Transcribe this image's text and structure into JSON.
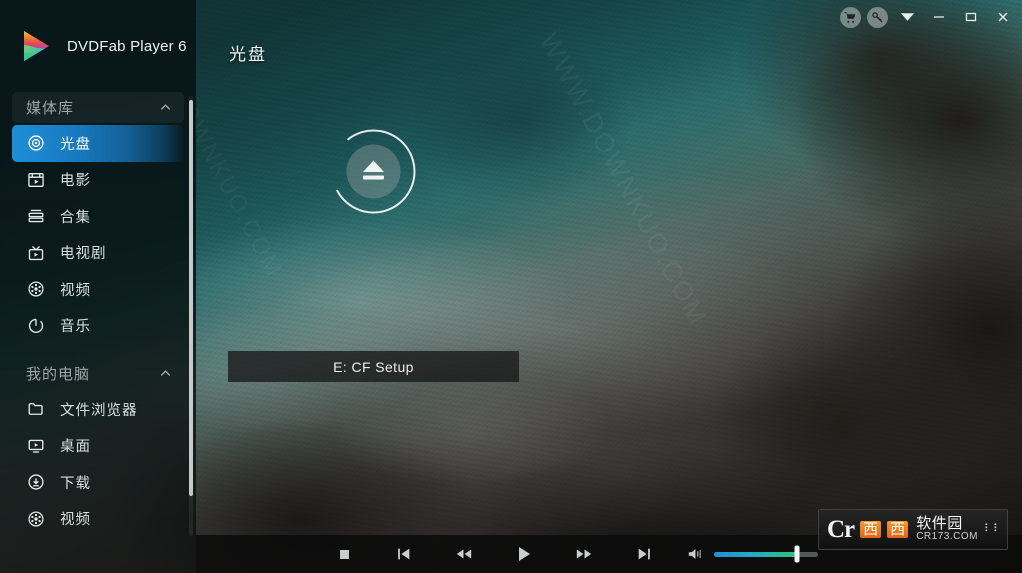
{
  "window": {
    "app_title": "DVDFab Player 6",
    "logo_icon": "play-triangle-rainbow-logo",
    "buttons": [
      {
        "name": "cart-icon",
        "label": "",
        "tooltip": "Store"
      },
      {
        "name": "key-icon",
        "label": "",
        "tooltip": "Activate"
      },
      {
        "name": "caret-down-icon",
        "label": "",
        "tooltip": "Menu"
      },
      {
        "name": "minimize-icon",
        "label": "–",
        "tooltip": "Minimize"
      },
      {
        "name": "maximize-icon",
        "label": "□",
        "tooltip": "Maximize"
      },
      {
        "name": "close-icon",
        "label": "✕",
        "tooltip": "Close"
      }
    ]
  },
  "sidebar": {
    "sections": [
      {
        "title": "媒体库",
        "collapse_icon": "chevron-up-icon",
        "highlighted_header": true,
        "items": [
          {
            "label": "光盘",
            "icon": "disc-icon",
            "active": true
          },
          {
            "label": "电影",
            "icon": "movie-icon",
            "active": false
          },
          {
            "label": "合集",
            "icon": "collection-icon",
            "active": false
          },
          {
            "label": "电视剧",
            "icon": "tv-icon",
            "active": false
          },
          {
            "label": "视频",
            "icon": "film-reel-icon",
            "active": false
          },
          {
            "label": "音乐",
            "icon": "music-icon",
            "active": false
          }
        ]
      },
      {
        "title": "我的电脑",
        "collapse_icon": "chevron-up-icon",
        "highlighted_header": false,
        "items": [
          {
            "label": "文件浏览器",
            "icon": "folder-icon",
            "active": false
          },
          {
            "label": "桌面",
            "icon": "desktop-icon",
            "active": false
          },
          {
            "label": "下载",
            "icon": "download-icon",
            "active": false
          },
          {
            "label": "视频",
            "icon": "film-reel-icon",
            "active": false
          }
        ]
      }
    ],
    "scrollbar": {
      "name": "sidebar-scrollbar",
      "thumb_pct": 90
    }
  },
  "main": {
    "page_title": "光盘",
    "disc": {
      "eject_icon": "eject-icon",
      "ring_icon": "progress-ring",
      "drive_label": "E: CF Setup"
    }
  },
  "controls": {
    "buttons": [
      {
        "name": "stop-button",
        "icon": "stop-icon"
      },
      {
        "name": "previous-button",
        "icon": "skip-previous-icon"
      },
      {
        "name": "rewind-button",
        "icon": "rewind-icon"
      },
      {
        "name": "play-button",
        "icon": "play-icon"
      },
      {
        "name": "fast-forward-button",
        "icon": "fast-forward-icon"
      },
      {
        "name": "next-button",
        "icon": "skip-next-icon"
      },
      {
        "name": "volume-button",
        "icon": "volume-icon"
      }
    ],
    "volume": {
      "value": 80,
      "min": 0,
      "max": 100
    }
  },
  "watermark": {
    "cr": "Cr",
    "box1": "西",
    "box2": "西",
    "cn": "软件园",
    "url": "CR173.COM",
    "dots": "⠇⠇"
  },
  "background": {
    "watermark_text_1": "WWW.DOWNKUO.COM",
    "watermark_text_2": "WWW.DOWNKUO.COM"
  },
  "colors": {
    "accent_blue": "#1e8fd8",
    "volume_start": "#1f8fd8",
    "volume_end": "#2fc47a",
    "sidebar_bg": "#08161a",
    "text_primary": "#e9eeee"
  }
}
